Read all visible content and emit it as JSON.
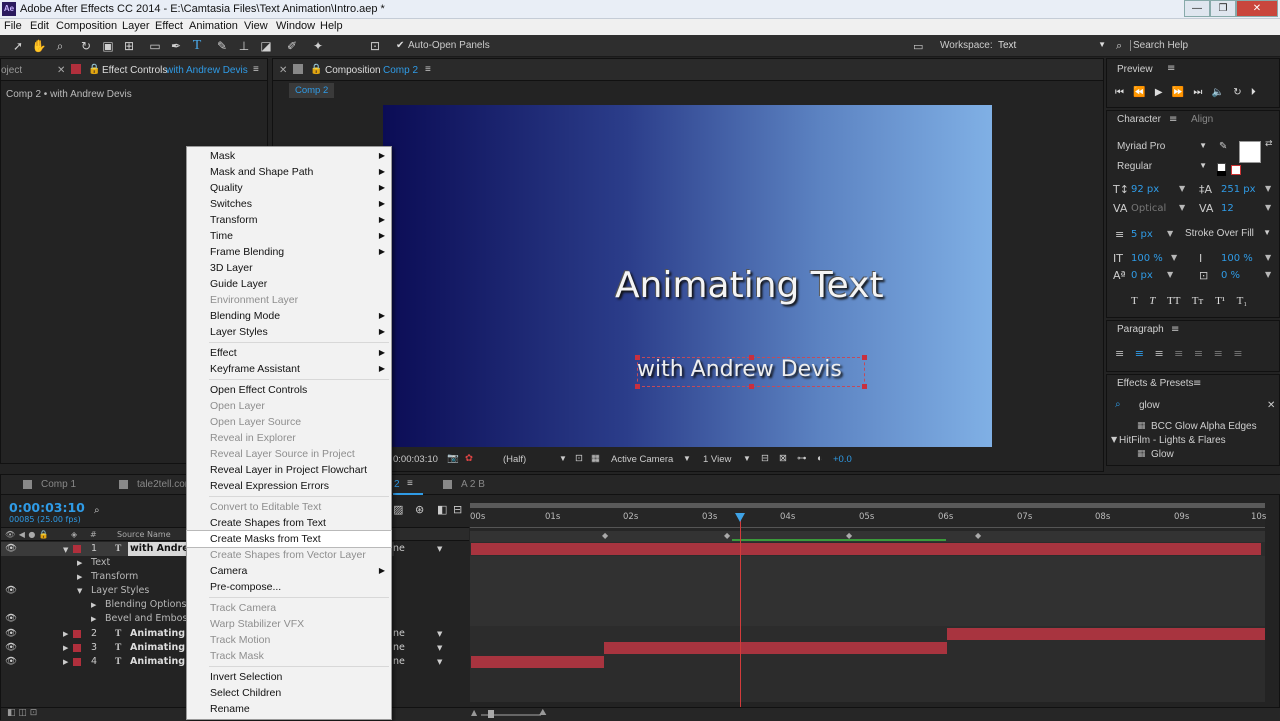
{
  "window": {
    "title": "Adobe After Effects CC 2014 - E:\\Camtasia Files\\Text Animation\\Intro.aep *",
    "app_icon": "Ae",
    "minimize": "—",
    "restore": "❐",
    "close": "✕"
  },
  "menubar": {
    "items": [
      "File",
      "Edit",
      "Composition",
      "Layer",
      "Effect",
      "Animation",
      "View",
      "Window",
      "Help"
    ]
  },
  "toolbar": {
    "auto_open": "Auto-Open Panels",
    "workspace_label": "Workspace:",
    "workspace_value": "Text",
    "search_help": "Search Help"
  },
  "left_panel": {
    "tab_project": "oject",
    "tab_effect_controls": "Effect Controls",
    "effect_target": "with Andrew Devis",
    "breadcrumb": "Comp 2 • with Andrew Devis"
  },
  "comp_panel": {
    "tab_label": "Composition",
    "tab_comp": "Comp 2",
    "sub_tab": "Comp 2",
    "title_text": "Animating Text",
    "subtitle_text": "with Andrew Devis",
    "timecode": "0:00:03:10",
    "resolution": "(Half)",
    "camera": "Active Camera",
    "views": "1 View",
    "exposure": "+0.0"
  },
  "timeline": {
    "tabs": [
      "Comp 1",
      "tale2tell.com",
      "2",
      "A 2 B"
    ],
    "timecode": "0:00:03:10",
    "frames": "00085 (25.00 fps)",
    "col_hash": "#",
    "col_source": "Source Name",
    "ruler_labels": [
      "00s",
      "01s",
      "02s",
      "03s",
      "04s",
      "05s",
      "06s",
      "07s",
      "08s",
      "09s",
      "10s"
    ],
    "layers": [
      {
        "num": "1",
        "name": "with Andrew",
        "mode": "ne"
      },
      {
        "name": "Text"
      },
      {
        "name": "Transform"
      },
      {
        "name": "Layer Styles"
      },
      {
        "name": "Blending Options"
      },
      {
        "name": "Bevel and Emboss"
      },
      {
        "num": "2",
        "name": "Animating T",
        "mode": "ne"
      },
      {
        "num": "3",
        "name": "Animating T",
        "mode": "ne"
      },
      {
        "num": "4",
        "name": "Animating T",
        "mode": "ne"
      }
    ]
  },
  "context_menu": {
    "items": [
      {
        "label": "Mask",
        "sub": true
      },
      {
        "label": "Mask and Shape Path",
        "sub": true
      },
      {
        "label": "Quality",
        "sub": true
      },
      {
        "label": "Switches",
        "sub": true
      },
      {
        "label": "Transform",
        "sub": true
      },
      {
        "label": "Time",
        "sub": true
      },
      {
        "label": "Frame Blending",
        "sub": true
      },
      {
        "label": "3D Layer"
      },
      {
        "label": "Guide Layer"
      },
      {
        "label": "Environment Layer",
        "disabled": true
      },
      {
        "label": "Blending Mode",
        "sub": true
      },
      {
        "label": "Layer Styles",
        "sub": true
      },
      {
        "separator": true
      },
      {
        "label": "Effect",
        "sub": true
      },
      {
        "label": "Keyframe Assistant",
        "sub": true
      },
      {
        "separator": true
      },
      {
        "label": "Open Effect Controls"
      },
      {
        "label": "Open Layer",
        "disabled": true
      },
      {
        "label": "Open Layer Source",
        "disabled": true
      },
      {
        "label": "Reveal in Explorer",
        "disabled": true
      },
      {
        "label": "Reveal Layer Source in Project",
        "disabled": true
      },
      {
        "label": "Reveal Layer in Project Flowchart"
      },
      {
        "label": "Reveal Expression Errors"
      },
      {
        "separator": true
      },
      {
        "label": "Convert to Editable Text",
        "disabled": true
      },
      {
        "label": "Create Shapes from Text"
      },
      {
        "label": "Create Masks from Text",
        "highlighted": true
      },
      {
        "label": "Create Shapes from Vector Layer",
        "disabled": true
      },
      {
        "label": "Camera",
        "sub": true
      },
      {
        "label": "Pre-compose..."
      },
      {
        "separator": true
      },
      {
        "label": "Track Camera",
        "disabled": true
      },
      {
        "label": "Warp Stabilizer VFX",
        "disabled": true
      },
      {
        "label": "Track Motion",
        "disabled": true
      },
      {
        "label": "Track Mask",
        "disabled": true
      },
      {
        "separator": true
      },
      {
        "label": "Invert Selection"
      },
      {
        "label": "Select Children"
      },
      {
        "label": "Rename"
      }
    ]
  },
  "preview_panel": {
    "title": "Preview"
  },
  "character_panel": {
    "tab": "Character",
    "tab2": "Align",
    "font": "Myriad Pro",
    "style": "Regular",
    "size": "92 px",
    "leading": "251 px",
    "kerning": "Optical",
    "tracking": "12",
    "stroke": "5 px",
    "stroke_mode": "Stroke Over Fill",
    "vscale": "100 %",
    "hscale": "100 %",
    "baseline": "0 px",
    "tsume": "0 %",
    "styles": [
      "T",
      "T",
      "TT",
      "Tт",
      "T¹",
      "T₁"
    ]
  },
  "paragraph_panel": {
    "title": "Paragraph"
  },
  "effects_panel": {
    "title": "Effects & Presets",
    "search": "glow",
    "item1": "BCC Glow Alpha Edges",
    "group": "HitFilm - Lights & Flares",
    "item2": "Glow"
  }
}
